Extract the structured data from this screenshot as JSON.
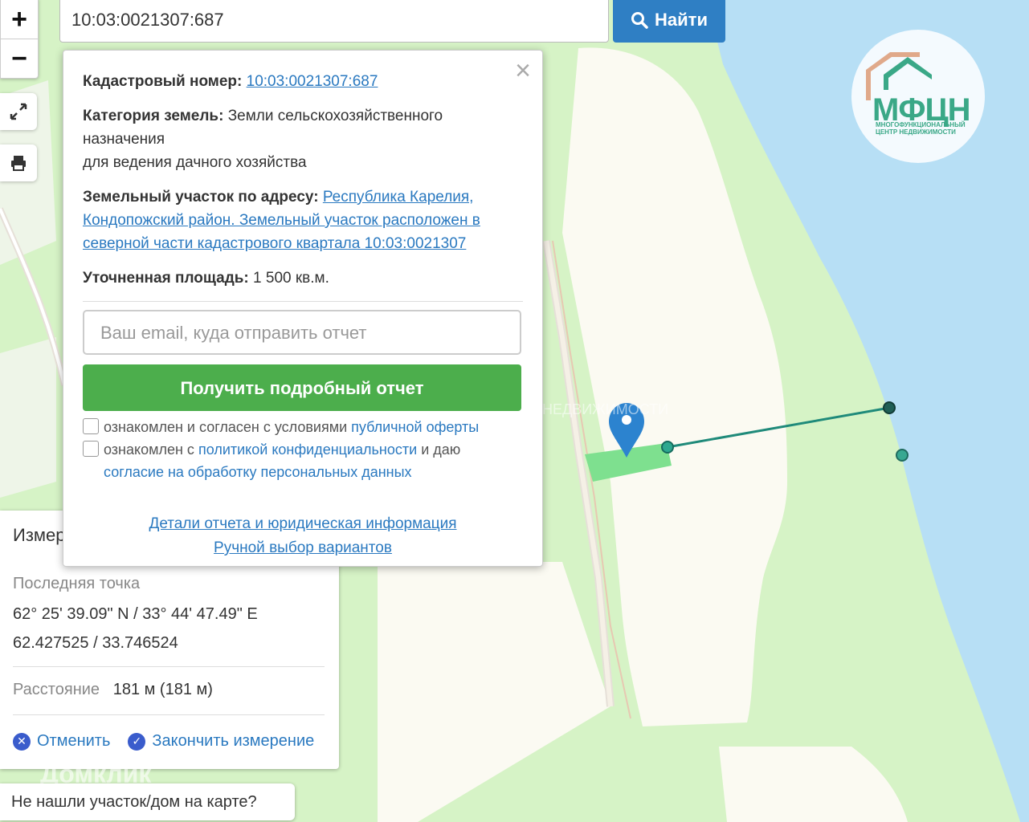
{
  "search": {
    "value": "10:03:0021307:687",
    "button_label": "Найти"
  },
  "zoom": {
    "in_label": "+",
    "out_label": "−"
  },
  "popup": {
    "cad_label": "Кадастровый номер:",
    "cad_value": "10:03:0021307:687",
    "cat_label": "Категория земель:",
    "cat_value": "Земли сельскохозяйственного назначения",
    "cat_value_2": "для ведения дачного хозяйства",
    "addr_label": "Земельный участок по адресу:",
    "addr_value": "Республика Карелия, Кондопожский район. Земельный участок расположен в северной части кадастрового квартала 10:03:0021307",
    "area_label": "Уточненная площадь:",
    "area_value": "1 500 кв.м.",
    "email_placeholder": "Ваш email, куда отправить отчет",
    "report_button": "Получить подробный отчет",
    "check1_text": "ознакомлен и согласен с условиями",
    "check1_link": "публичной оферты",
    "check2_text_a": "ознакомлен с",
    "check2_link": "политикой конфиденциальности",
    "check2_text_b": "и даю",
    "check2_link2": "согласие на обработку персональных данных",
    "link_details": "Детали отчета и юридическая информация",
    "link_manual": "Ручной выбор вариантов"
  },
  "measure": {
    "title": "Измер",
    "last_point_label": "Последняя точка",
    "coords_dms": "62° 25' 39.09\" N / 33° 44' 47.49\" E",
    "coords_dec": "62.427525 / 33.746524",
    "distance_label": "Расстояние",
    "distance_value": "181 м (181 м)",
    "cancel_label": "Отменить",
    "finish_label": "Закончить измерение"
  },
  "not_found_label": "Не нашли участок/дом на карте?",
  "watermark_domclick": "Домклик",
  "watermark_mfcn": "МНОГОФУНКЦИОНАЛЬНЫЙ ЦЕНТР НЕДВИЖИМОСТИ",
  "logo": {
    "name": "МФЦН",
    "subtitle": "МНОГОФУНКЦИОНАЛЬНЫЙ ЦЕНТР НЕДВИЖИМОСТИ"
  },
  "colors": {
    "water": "#b7dff5",
    "land": "#d6f3c6",
    "field": "#fbfaf2",
    "parcel": "#7ee08f",
    "measure_line": "#1f8a7a",
    "accent": "#2a79c0",
    "button_green": "#4cae4c"
  }
}
